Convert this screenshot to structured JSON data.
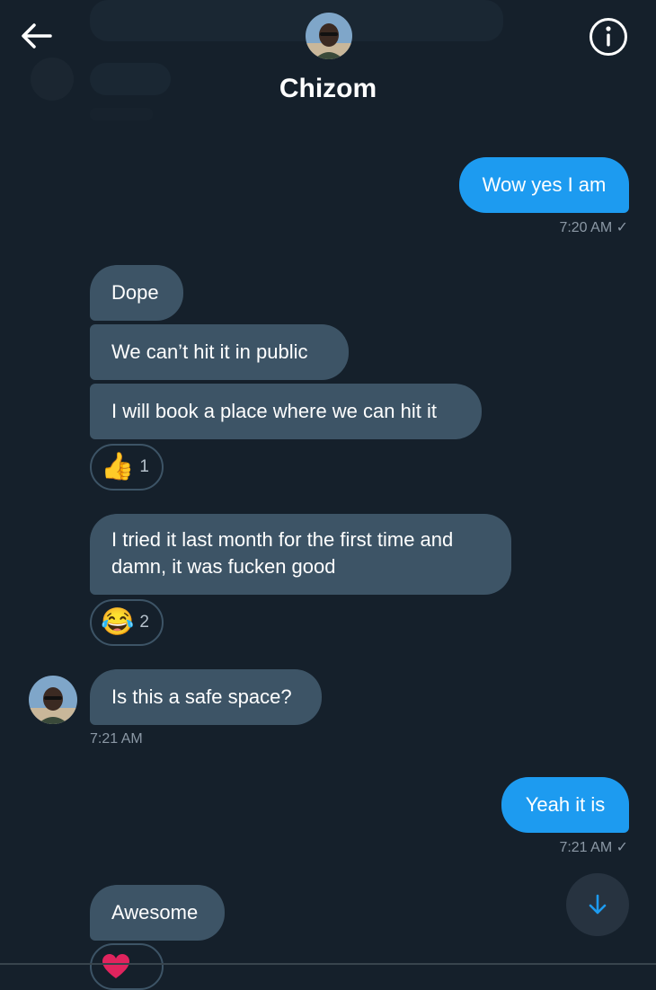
{
  "header": {
    "title": "Chizom",
    "back_icon": "arrow-left-icon",
    "info_icon": "info-circle-icon"
  },
  "messages": [
    {
      "direction": "outgoing",
      "text": "Wow yes I am",
      "timestamp": "7:20 AM ✓"
    },
    {
      "direction": "incoming",
      "text": "Dope"
    },
    {
      "direction": "incoming",
      "text": "We can’t hit it in public"
    },
    {
      "direction": "incoming",
      "text": "I will book a place where we can hit it",
      "reaction": {
        "emoji": "👍",
        "icon": "thumbs-up-icon",
        "count": "1"
      }
    },
    {
      "direction": "incoming",
      "text": "I tried it last month for the first time and damn, it was fucken good",
      "reaction": {
        "emoji": "😂",
        "icon": "tears-of-joy-icon",
        "count": "2"
      }
    },
    {
      "direction": "incoming",
      "text": "Is this a safe space?",
      "timestamp": "7:21 AM"
    },
    {
      "direction": "outgoing",
      "text": "Yeah it is",
      "timestamp": "7:21 AM ✓"
    },
    {
      "direction": "incoming",
      "text": "Awesome",
      "reaction": {
        "icon": "heart-icon"
      }
    }
  ],
  "scroll_button": {
    "icon": "arrow-down-icon"
  },
  "colors": {
    "background": "#15202b",
    "incoming_bubble": "#3d5466",
    "outgoing_bubble": "#1d9bf0",
    "timestamp": "#8b98a5",
    "accent": "#1d9bf0"
  }
}
